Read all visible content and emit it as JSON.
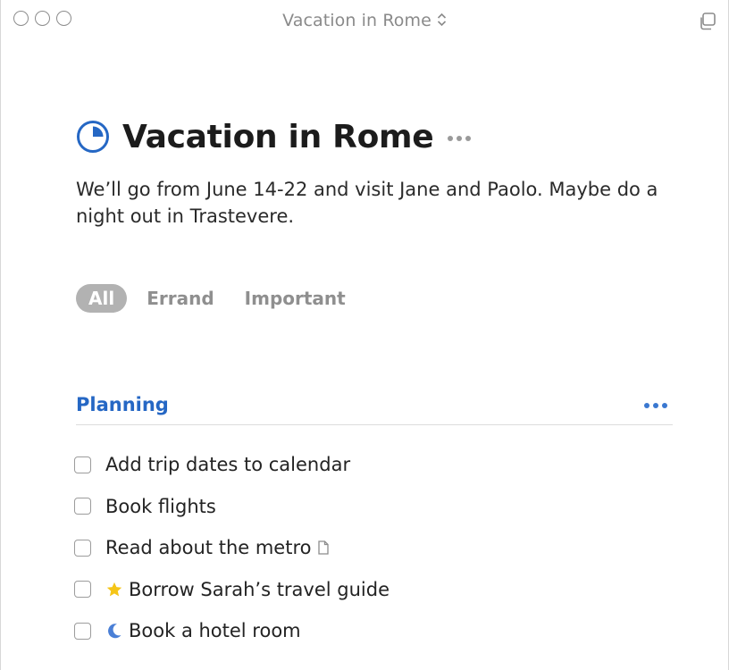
{
  "window": {
    "title": "Vacation in Rome",
    "controls": [
      "close-button",
      "minimize-button",
      "zoom-button"
    ]
  },
  "project": {
    "title": "Vacation in Rome",
    "notes": "We’ll go from June 14-22 and visit Jane and Paolo. Maybe do a night out in Trastevere.",
    "progress_icon": "pie-progress-icon"
  },
  "tags": {
    "selected": "All",
    "items": [
      "All",
      "Errand",
      "Important"
    ]
  },
  "section": {
    "title": "Planning",
    "more_icon": "more-icon",
    "todos": [
      {
        "label": "Add trip dates to calendar",
        "icon": null
      },
      {
        "label": "Book flights",
        "icon": null
      },
      {
        "label": "Read about the metro",
        "icon": "note-icon"
      },
      {
        "label": "Borrow Sarah’s travel guide",
        "icon": "star-icon"
      },
      {
        "label": "Book a hotel room",
        "icon": "moon-icon"
      }
    ]
  },
  "colors": {
    "accent": "#2567c4",
    "star": "#f5c518",
    "moon": "#4a7fd6",
    "tag_selected_bg": "#b2b2b2"
  }
}
